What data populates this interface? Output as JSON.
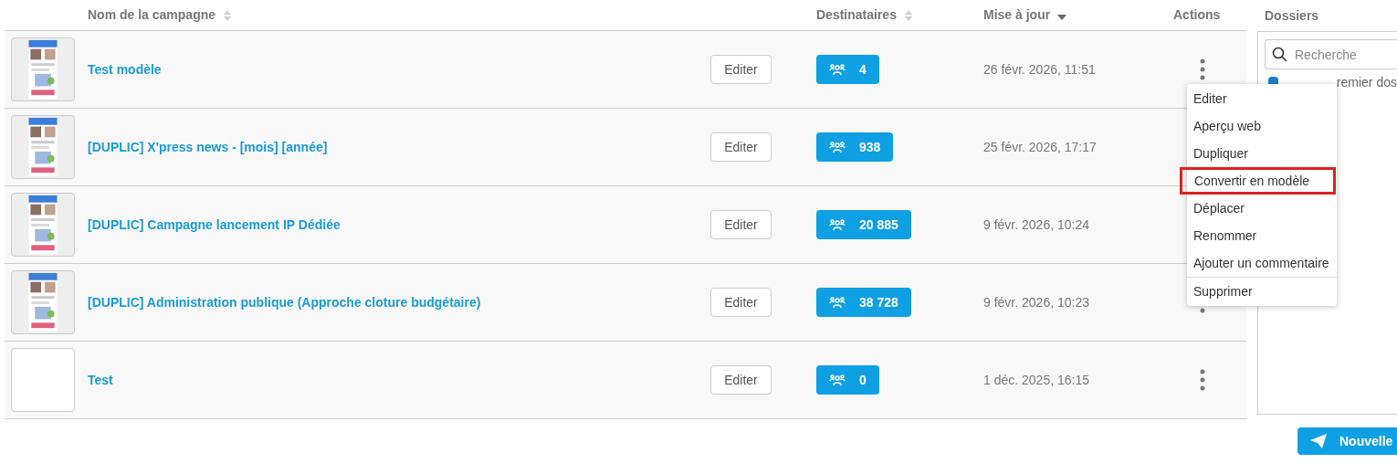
{
  "table": {
    "columns": [
      {
        "label": "Nom de la campagne",
        "sortable": true,
        "sorted": false
      },
      {
        "label": "Destinataires",
        "sortable": true,
        "sorted": false
      },
      {
        "label": "Mise à jour",
        "sortable": true,
        "sorted": true
      },
      {
        "label": "Actions",
        "sortable": false
      }
    ],
    "rows": [
      {
        "name": "Test modèle",
        "edit": "Editer",
        "recipients": "4",
        "updated": "26 févr. 2026, 11:51"
      },
      {
        "name": "[DUPLIC] X'press news - [mois] [année]",
        "edit": "Editer",
        "recipients": "938",
        "updated": "25 févr. 2026, 17:17",
        "actions_covered": true
      },
      {
        "name": "[DUPLIC] Campagne lancement IP Dédiée",
        "edit": "Editer",
        "recipients": "20 885",
        "updated": "9 févr. 2026, 10:24",
        "actions_covered": true
      },
      {
        "name": "[DUPLIC] Administration publique (Approche cloture budgétaire)",
        "edit": "Editer",
        "recipients": "38 728",
        "updated": "9 févr. 2026, 10:23"
      },
      {
        "thumbnail": {
          "kind": "blank"
        },
        "name": "Test",
        "edit": "Editer",
        "recipients": "0",
        "updated": "1 déc. 2025, 16:15"
      }
    ]
  },
  "context_menu": {
    "items": [
      {
        "label": "Editer",
        "highlighted": false,
        "divider_before": false
      },
      {
        "label": "Aperçu web",
        "highlighted": false,
        "divider_before": false
      },
      {
        "label": "Dupliquer",
        "highlighted": false,
        "divider_before": false
      },
      {
        "label": "Convertir en modèle",
        "highlighted": true,
        "divider_before": false
      },
      {
        "label": "Déplacer",
        "highlighted": false,
        "divider_before": false
      },
      {
        "label": "Renommer",
        "highlighted": false,
        "divider_before": false
      },
      {
        "label": "Ajouter un commentaire",
        "highlighted": false,
        "divider_before": false
      },
      {
        "label": "Supprimer",
        "highlighted": false,
        "divider_before": true
      }
    ]
  },
  "folders": {
    "title": "Dossiers",
    "search": {
      "placeholder": "Recherche"
    },
    "items": [
      {
        "label": "remier dos",
        "checked": true
      }
    ]
  },
  "new_button": "Nouvelle"
}
